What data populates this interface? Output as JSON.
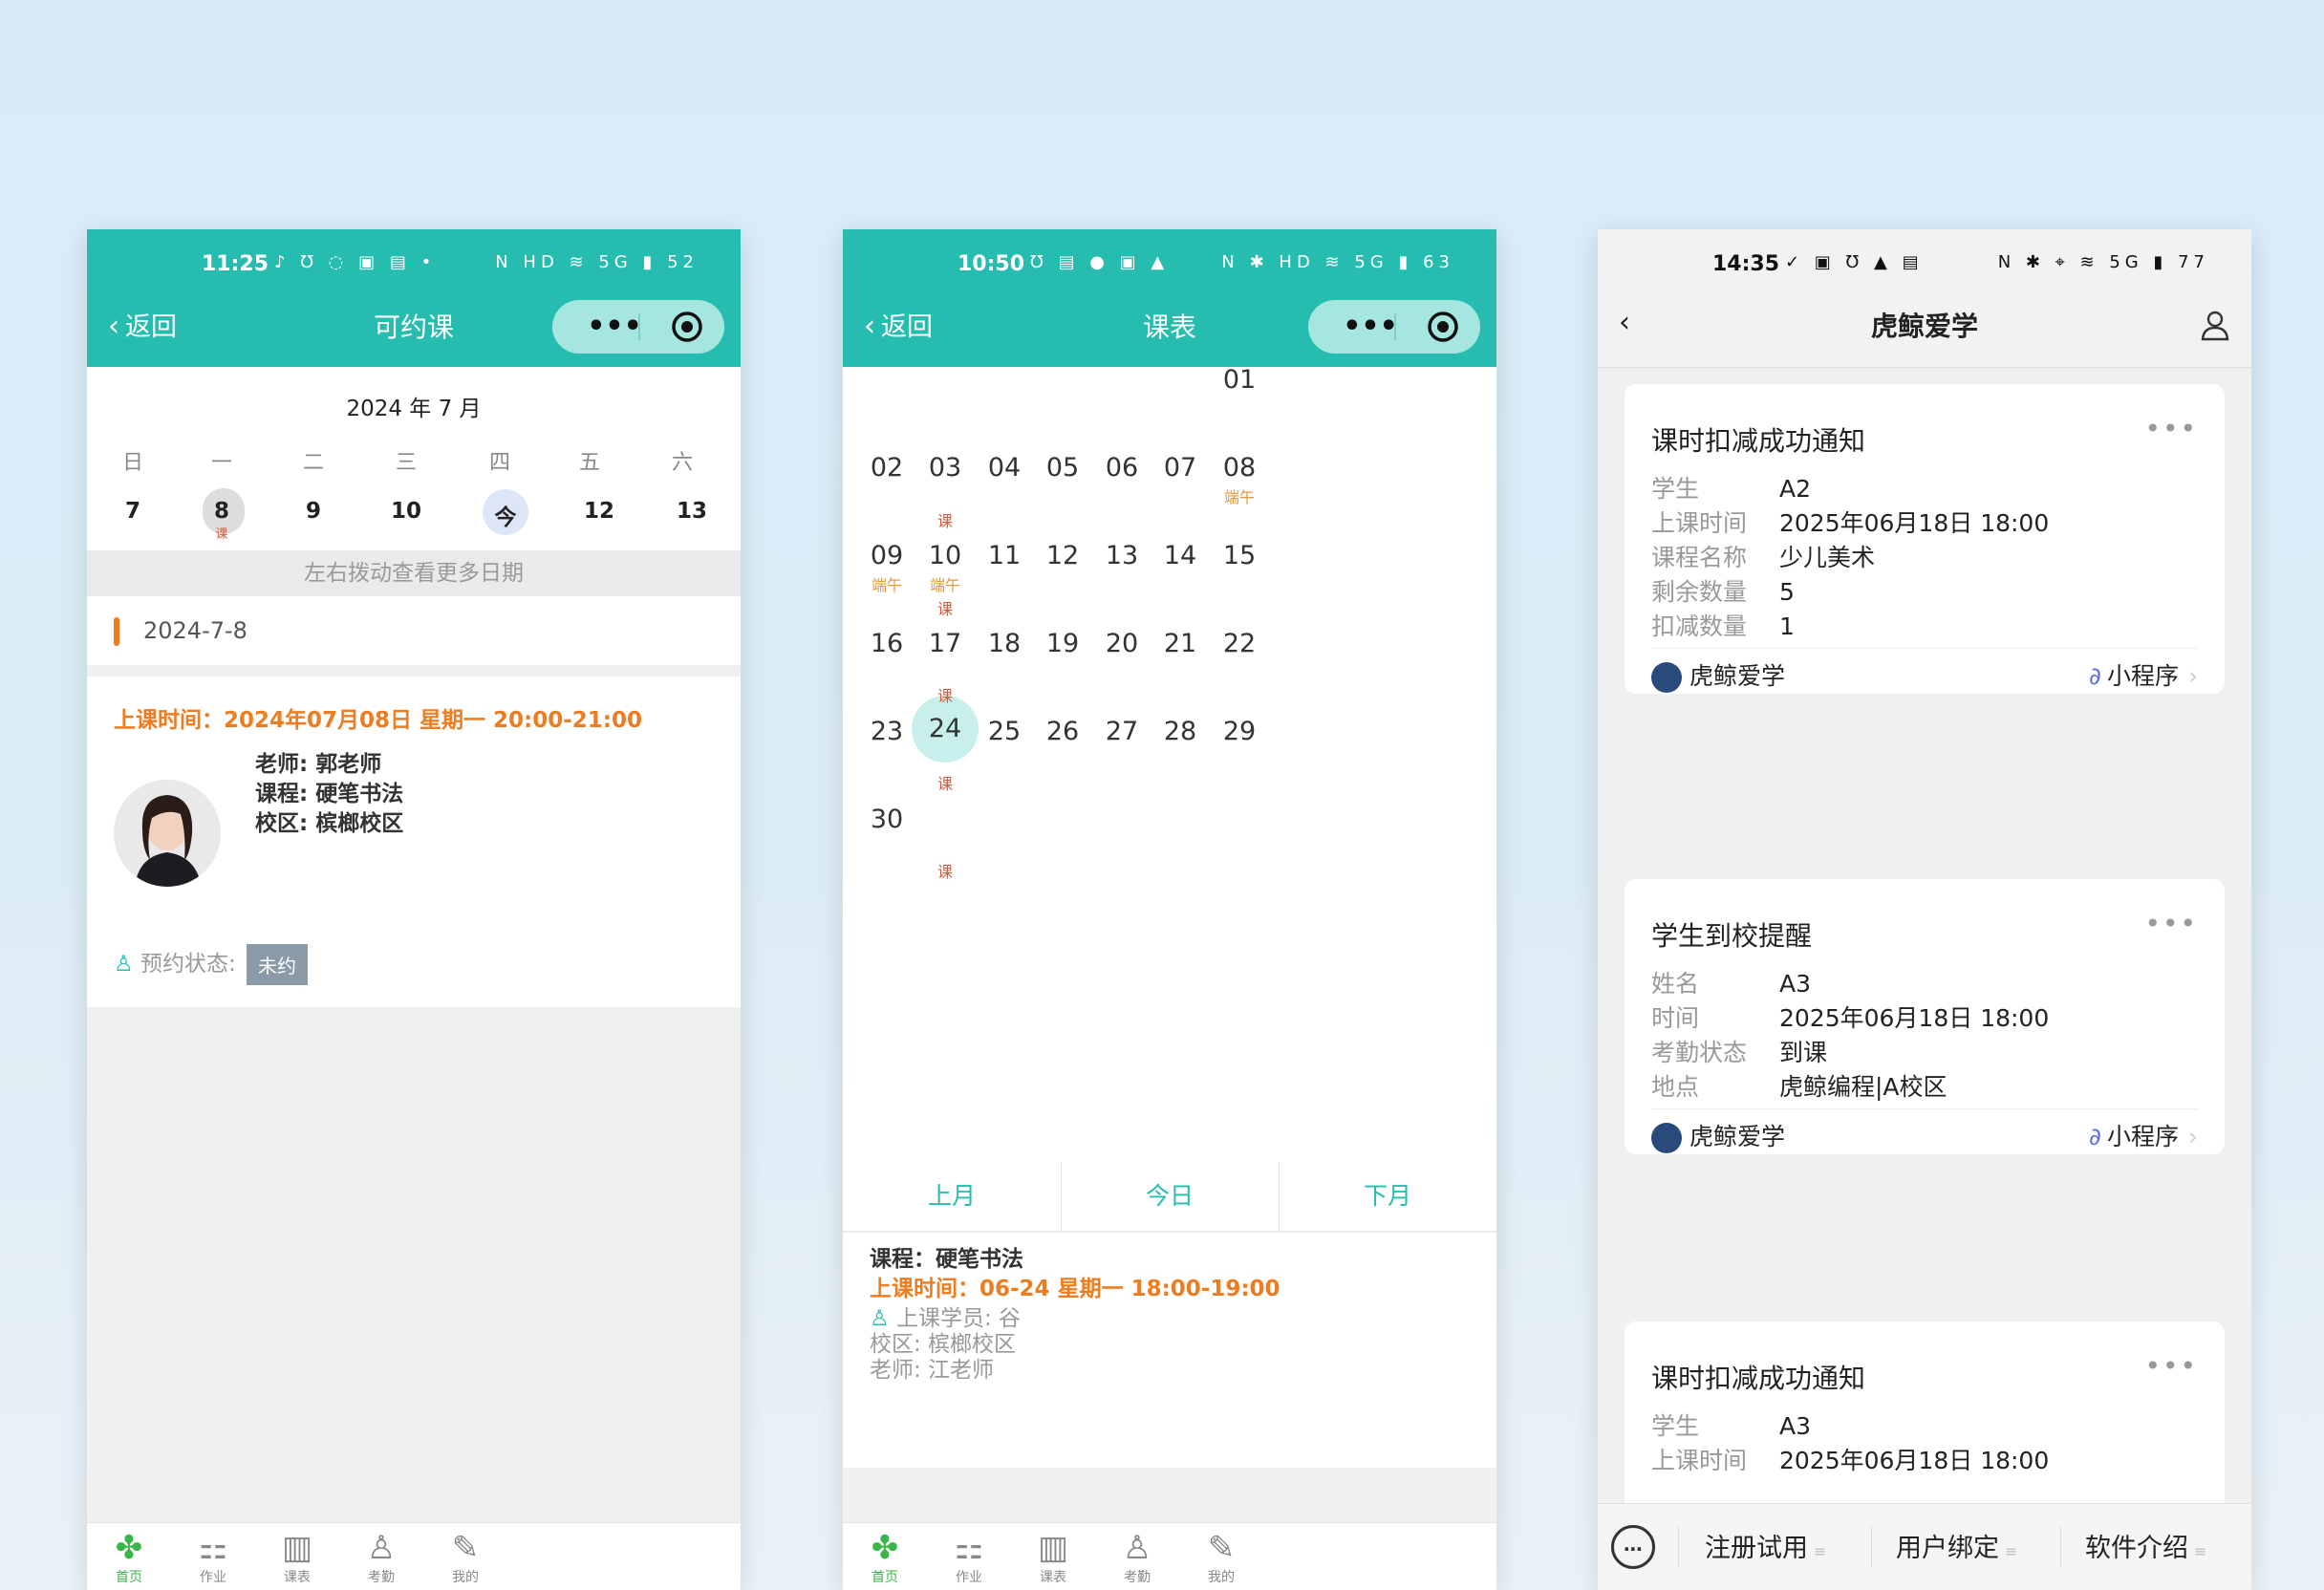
{
  "phone1": {
    "status": {
      "time": "11:25",
      "left_icons": "♪ Ʊ ◌ ▣ ▤ •",
      "right_icons": "N HD ≋ 5G ▮ 52"
    },
    "nav": {
      "back": "返回",
      "title": "可约课",
      "more": "•••"
    },
    "month": "2024 年 7 月",
    "weekdays": [
      "日",
      "一",
      "二",
      "三",
      "四",
      "五",
      "六"
    ],
    "days": [
      "7",
      "8",
      "9",
      "10",
      "今",
      "12",
      "13"
    ],
    "day8_mark": "课",
    "hint": "左右拨动查看更多日期",
    "selected_date": "2024-7-8",
    "lesson": {
      "time": "上课时间：2024年07月08日 星期一 20:00-21:00",
      "teacher": "老师: 郭老师",
      "course": "课程: 硬笔书法",
      "campus": "校区: 槟榔校区",
      "status_label": "预约状态:",
      "status_value": "未约"
    }
  },
  "phone2": {
    "status": {
      "time": "10:50",
      "left_icons": "Ʊ ▤ ● ▣ ▲",
      "right_icons": "N ✱ HD ≋ 5G ▮ 63"
    },
    "nav": {
      "back": "返回",
      "title": "课表",
      "more": "•••"
    },
    "dates": [
      "01",
      "02",
      "03",
      "04",
      "05",
      "06",
      "07",
      "08",
      "09",
      "10",
      "11",
      "12",
      "13",
      "14",
      "15",
      "16",
      "17",
      "18",
      "19",
      "20",
      "21",
      "22",
      "23",
      "24",
      "25",
      "26",
      "27",
      "28",
      "29",
      "30"
    ],
    "marks": {
      "ke": "课",
      "duanwu": "端午"
    },
    "nav_buttons": [
      "上月",
      "今日",
      "下月"
    ],
    "detail": {
      "course": "课程：硬笔书法",
      "time": "上课时间：06-24 星期一 18:00-19:00",
      "student": "上课学员: 谷",
      "campus": "校区: 槟榔校区",
      "teacher": "老师: 江老师"
    }
  },
  "phone3": {
    "status": {
      "time": "14:35",
      "left_icons": "✓ ▣ Ʊ ▲ ▤",
      "right_icons": "N ✱ ⌖ ≋ 5G ▮ 77"
    },
    "title": "虎鲸爱学",
    "cards": [
      {
        "title": "课时扣减成功通知",
        "rows": [
          {
            "k": "学生",
            "v": "A2"
          },
          {
            "k": "上课时间",
            "v": "2025年06月18日 18:00"
          },
          {
            "k": "课程名称",
            "v": "少儿美术"
          },
          {
            "k": "剩余数量",
            "v": "5"
          },
          {
            "k": "扣减数量",
            "v": "1"
          }
        ],
        "source": "虎鲸爱学",
        "mini": "小程序"
      },
      {
        "title": "学生到校提醒",
        "rows": [
          {
            "k": "姓名",
            "v": "A3"
          },
          {
            "k": "时间",
            "v": "2025年06月18日 18:00"
          },
          {
            "k": "考勤状态",
            "v": "到课"
          },
          {
            "k": "地点",
            "v": "虎鲸编程|A校区"
          }
        ],
        "source": "虎鲸爱学",
        "mini": "小程序"
      },
      {
        "title": "课时扣减成功通知",
        "rows": [
          {
            "k": "学生",
            "v": "A3"
          },
          {
            "k": "上课时间",
            "v": "2025年06月18日 18:00"
          }
        ]
      }
    ],
    "bottom_menu": [
      "注册试用",
      "用户绑定",
      "软件介绍"
    ]
  },
  "tabbar": {
    "items": [
      "首页",
      "作业",
      "课表",
      "考勤",
      "我的"
    ],
    "icons": [
      "home-icon",
      "homework-icon",
      "schedule-icon",
      "attendance-icon",
      "profile-icon"
    ]
  },
  "colors": {
    "teal": "#26bdb0",
    "orange": "#ee7d22",
    "tab_active": "#39b54a"
  }
}
